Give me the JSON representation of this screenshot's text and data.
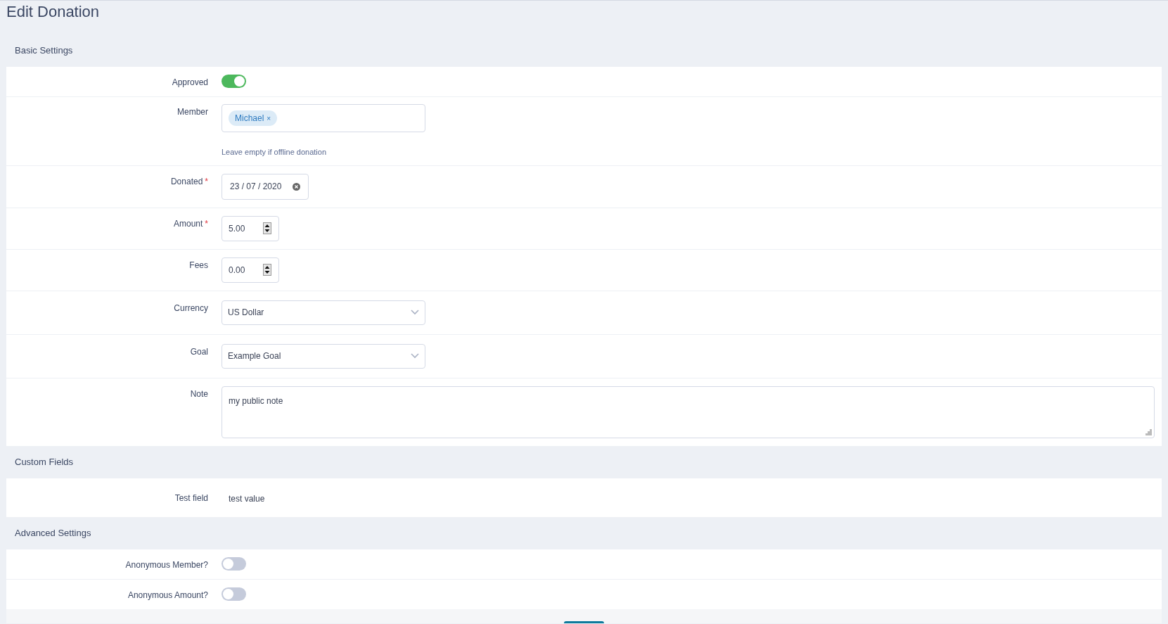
{
  "title": "Edit Donation",
  "sections": [
    {
      "heading": "Basic Settings",
      "rows": [
        {
          "kind": "toggle",
          "label": "Approved",
          "required": false,
          "on": true
        },
        {
          "kind": "tags",
          "label": "Member",
          "required": false,
          "tags": [
            "Michael"
          ],
          "remove": "×",
          "help": "Leave empty if offline donation"
        },
        {
          "kind": "date",
          "label": "Donated",
          "required": true,
          "value": "23 / 07 / 2020"
        },
        {
          "kind": "number",
          "label": "Amount",
          "required": true,
          "value": "5.00"
        },
        {
          "kind": "number",
          "label": "Fees",
          "required": false,
          "value": "0.00"
        },
        {
          "kind": "select",
          "label": "Currency",
          "required": false,
          "value": "US Dollar"
        },
        {
          "kind": "select",
          "label": "Goal",
          "required": false,
          "value": "Example Goal"
        },
        {
          "kind": "textarea",
          "label": "Note",
          "required": false,
          "value": "my public note"
        }
      ]
    },
    {
      "heading": "Custom Fields",
      "rows": [
        {
          "kind": "text",
          "label": "Test field",
          "required": false,
          "value": "test value"
        }
      ]
    },
    {
      "heading": "Advanced Settings",
      "rows": [
        {
          "kind": "toggle",
          "label": "Anonymous Member?",
          "required": false,
          "on": false
        },
        {
          "kind": "toggle",
          "label": "Anonymous Amount?",
          "required": false,
          "on": false
        }
      ]
    }
  ],
  "required_mark": "*"
}
